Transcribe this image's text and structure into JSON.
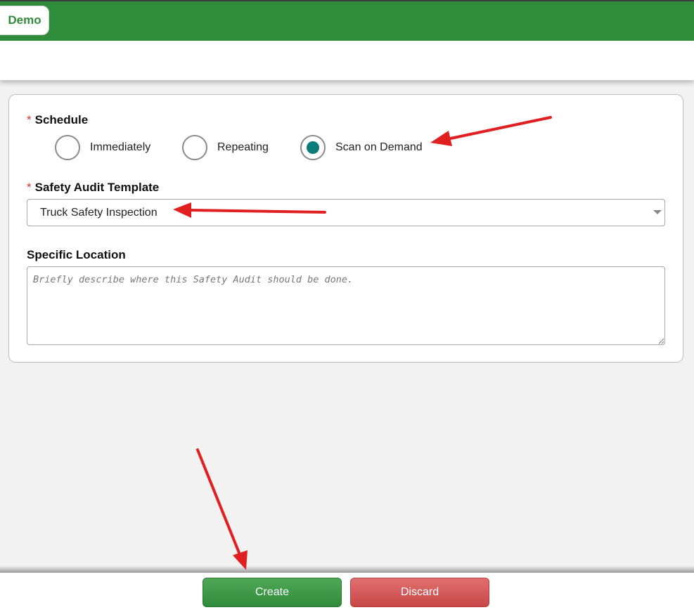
{
  "header": {
    "tab_label": "Demo"
  },
  "form": {
    "schedule": {
      "label": "Schedule",
      "required_mark": "*",
      "options": [
        {
          "label": "Immediately",
          "selected": false
        },
        {
          "label": "Repeating",
          "selected": false
        },
        {
          "label": "Scan on Demand",
          "selected": true
        }
      ]
    },
    "template": {
      "label": "Safety Audit Template",
      "required_mark": "*",
      "value": "Truck Safety Inspection"
    },
    "location": {
      "label": "Specific Location",
      "placeholder": "Briefly describe where this Safety Audit should be done.",
      "value": ""
    }
  },
  "footer": {
    "create_label": "Create",
    "discard_label": "Discard"
  },
  "colors": {
    "brand_green": "#2f8c3a",
    "radio_selected": "#0a7d7a",
    "required_star": "#dd3333",
    "discard_red": "#c84848",
    "annotation_arrow": "#e02020"
  }
}
